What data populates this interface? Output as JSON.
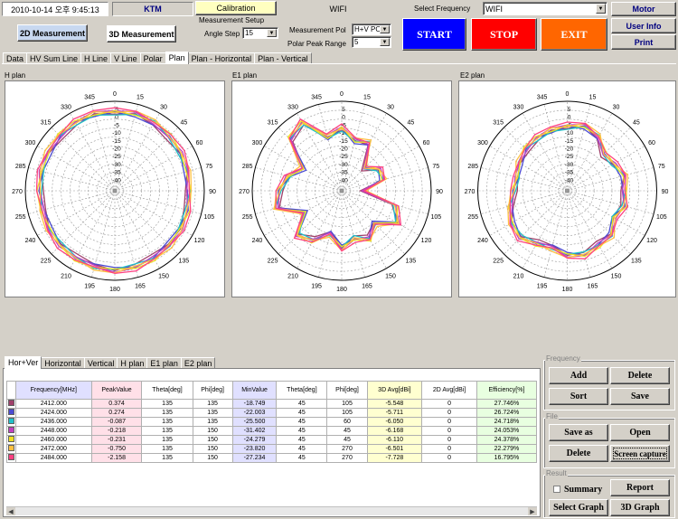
{
  "header": {
    "datetime": "2010-10-14 오후 9:45:13",
    "company": "KTM",
    "calibration_label": "Calibration",
    "wifi_label": "WIFI",
    "measure_2d_label": "2D Measurement",
    "measure_3d_label": "3D Measurement",
    "measurement_setup_label": "Measurement  Setup",
    "angle_step_label": "Angle Step",
    "angle_step_value": "15",
    "measurement_pol_label": "Measurement Pol",
    "measurement_pol_value": "H+V POL",
    "polar_peak_range_label": "Polar Peak Range",
    "polar_peak_range_value": "5",
    "select_frequency_label": "Select Frequency",
    "select_frequency_value": "WIFI",
    "start_label": "START",
    "stop_label": "STOP",
    "exit_label": "EXIT",
    "motor_label": "Motor",
    "user_info_label": "User Info",
    "print_label": "Print",
    "colors": {
      "start": "#0000ff",
      "stop": "#ff0000",
      "exit": "#ff6600"
    }
  },
  "top_tabs": [
    "Data",
    "HV Sum Line",
    "H Line",
    "V Line",
    "Polar",
    "Plan",
    "Plan - Horizontal",
    "Plan - Vertical"
  ],
  "active_top_tab": "Plan",
  "plots": [
    {
      "title": "H plan"
    },
    {
      "title": "E1 plan"
    },
    {
      "title": "E2 plan"
    }
  ],
  "polar_axis": {
    "angle_labels": [
      "0",
      "15",
      "30",
      "45",
      "60",
      "75",
      "90",
      "105",
      "120",
      "135",
      "150",
      "165",
      "180",
      "195",
      "210",
      "225",
      "240",
      "255",
      "270",
      "285",
      "300",
      "315",
      "330",
      "345"
    ],
    "radial_labels": [
      "5",
      "0",
      "-5",
      "-10",
      "-15",
      "-20",
      "-25",
      "-30",
      "-35",
      "-40"
    ]
  },
  "series_colors": [
    "#a0406a",
    "#4b4bd2",
    "#20c0c8",
    "#c040c0",
    "#f0e020",
    "#ffc040",
    "#ff4080"
  ],
  "bottom_tabs": [
    "Hor+Ver",
    "Horizontal",
    "Vertical",
    "H plan",
    "E1 plan",
    "E2 plan"
  ],
  "active_bottom_tab": "Hor+Ver",
  "table": {
    "headers": [
      "Frequency[MHz]",
      "PeakValue",
      "Theta[deg]",
      "Phi[deg]",
      "MinValue",
      "Theta[deg]",
      "Phi[deg]",
      "3D Avg[dBi]",
      "2D Avg[dBi]",
      "Efficiency[%]"
    ],
    "rows": [
      [
        "2412.000",
        "0.374",
        "135",
        "135",
        "-18.749",
        "45",
        "105",
        "-5.548",
        "0",
        "27.746%"
      ],
      [
        "2424.000",
        "0.274",
        "135",
        "135",
        "-22.003",
        "45",
        "105",
        "-5.711",
        "0",
        "26.724%"
      ],
      [
        "2436.000",
        "-0.087",
        "135",
        "135",
        "-25.500",
        "45",
        "60",
        "-6.050",
        "0",
        "24.718%"
      ],
      [
        "2448.000",
        "-0.218",
        "135",
        "150",
        "-31.402",
        "45",
        "45",
        "-6.168",
        "0",
        "24.053%"
      ],
      [
        "2460.000",
        "-0.231",
        "135",
        "150",
        "-24.279",
        "45",
        "45",
        "-6.110",
        "0",
        "24.378%"
      ],
      [
        "2472.000",
        "-0.750",
        "135",
        "150",
        "-23.820",
        "45",
        "270",
        "-6.501",
        "0",
        "22.279%"
      ],
      [
        "2484.000",
        "-2.158",
        "135",
        "150",
        "-27.234",
        "45",
        "270",
        "-7.728",
        "0",
        "16.795%"
      ]
    ]
  },
  "frequency_group": {
    "label": "Frequency",
    "add": "Add",
    "delete": "Delete",
    "sort": "Sort",
    "save": "Save"
  },
  "file_group": {
    "label": "File",
    "save_as": "Save as",
    "open": "Open",
    "delete": "Delete",
    "screen_capture": "Screen capture"
  },
  "result_group": {
    "label": "Result",
    "summary": "Summary",
    "report": "Report",
    "select_graph": "Select Graph",
    "graph_3d": "3D Graph"
  }
}
